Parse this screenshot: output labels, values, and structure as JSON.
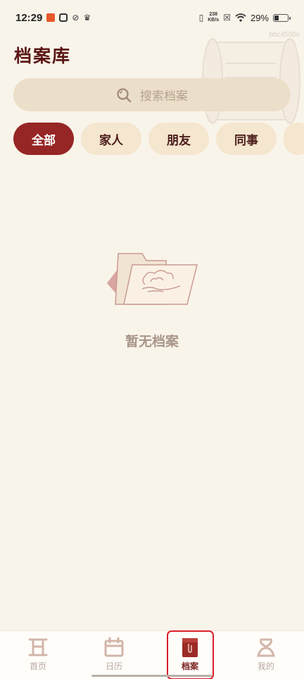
{
  "status_bar": {
    "time": "12:29",
    "net_speed_value": "238",
    "net_speed_unit": "KB/s",
    "battery_percent": "29%",
    "battery_level": 0.29
  },
  "watermark": "bbc4500c",
  "header": {
    "title": "档案库"
  },
  "search": {
    "placeholder": "搜索档案"
  },
  "filters": [
    {
      "label": "全部",
      "active": true
    },
    {
      "label": "家人",
      "active": false
    },
    {
      "label": "朋友",
      "active": false
    },
    {
      "label": "同事",
      "active": false
    }
  ],
  "empty_state": {
    "text": "暂无档案"
  },
  "bottom_nav": [
    {
      "label": "首页",
      "icon": "home-icon"
    },
    {
      "label": "日历",
      "icon": "calendar-icon"
    },
    {
      "label": "档案",
      "icon": "archive-icon",
      "active": true
    },
    {
      "label": "我的",
      "icon": "profile-icon"
    }
  ],
  "colors": {
    "background": "#f9f4ea",
    "accent": "#962625",
    "chip": "#f5e6cf",
    "search": "#ecdfc9",
    "highlight": "#d9202a"
  }
}
